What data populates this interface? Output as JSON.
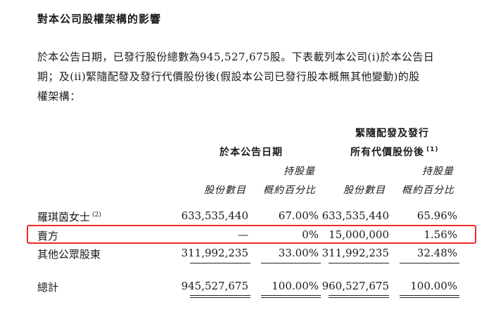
{
  "heading": "對本公司股權架構的影響",
  "paragraph": {
    "line1": "於本公告日期，已發行股份總數為945,527,675股。下表載列本公司(i)於本公告日",
    "line2": "期；及(ii)緊隨配發及發行代價股份後(假設本公司已發行股本概無其他變動)的股",
    "line3": "權架構："
  },
  "table": {
    "group_headers": {
      "date": "於本公告日期",
      "after_line1": "緊隨配發及發行",
      "after_line2": "所有代價股份後",
      "after_note": "(1)"
    },
    "col_headers": {
      "holding": "持股量",
      "shares": "股份數目",
      "percent": "概約百分比"
    },
    "rows": [
      {
        "label": "羅琪茵女士",
        "note": "(2)",
        "shares_now": "633,535,440",
        "pct_now": "67.00%",
        "shares_after": "633,535,440",
        "pct_after": "65.96%"
      },
      {
        "label": "賣方",
        "shares_now": "—",
        "pct_now": "0%",
        "shares_after": "15,000,000",
        "pct_after": "1.56%"
      },
      {
        "label": "其他公眾股東",
        "shares_now": "311,992,235",
        "pct_now": "33.00%",
        "shares_after": "311,992,235",
        "pct_after": "32.48%"
      }
    ],
    "total": {
      "label": "總計",
      "shares_now": "945,527,675",
      "pct_now": "100.00%",
      "shares_after": "960,527,675",
      "pct_after": "100.00%"
    }
  },
  "colors": {
    "highlight": "#ee2a2a",
    "text": "#1a1a1a"
  }
}
